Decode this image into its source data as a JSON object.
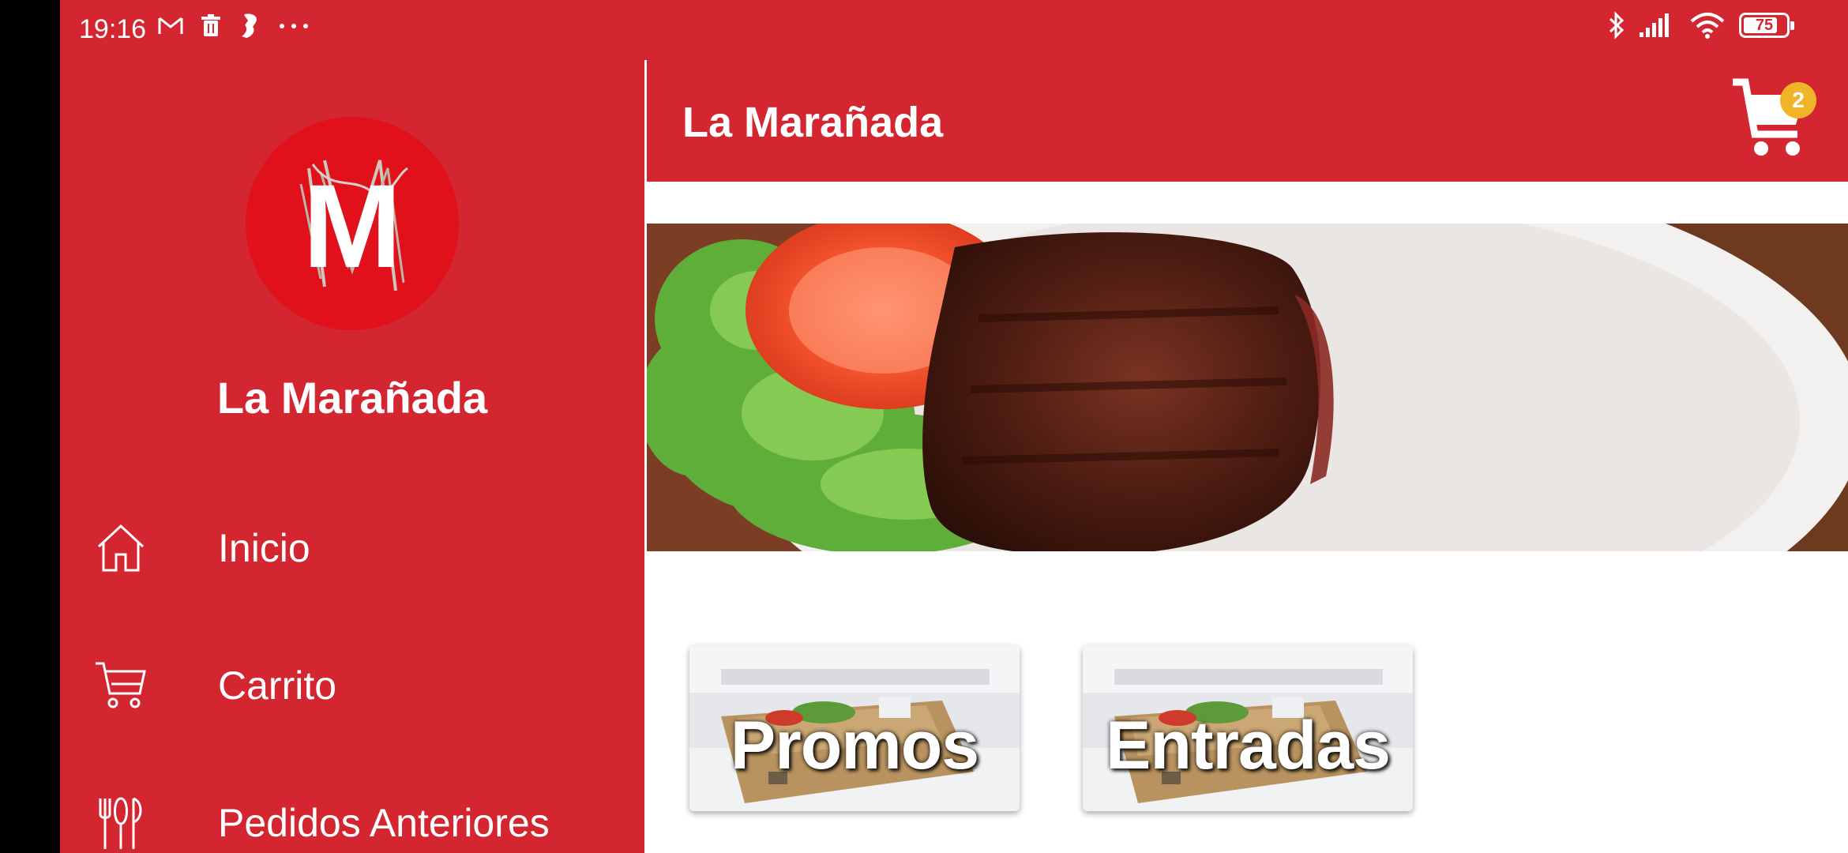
{
  "status_bar": {
    "time": "19:16",
    "left_icons": [
      "gmail-icon",
      "trash-icon",
      "app-notification-icon",
      "more-dots-icon"
    ],
    "right_icons": [
      "bluetooth-icon",
      "signal-icon",
      "wifi-icon"
    ],
    "battery": "75"
  },
  "drawer": {
    "logo_letter": "M",
    "title": "La Marañada",
    "items": [
      {
        "label": "Inicio",
        "icon": "home-icon"
      },
      {
        "label": "Carrito",
        "icon": "cart-icon"
      },
      {
        "label": "Pedidos Anteriores",
        "icon": "utensils-icon"
      }
    ]
  },
  "appbar": {
    "title": "La Marañada",
    "cart_count": "2"
  },
  "categories": [
    {
      "label": "Promos"
    },
    {
      "label": "Entradas"
    }
  ],
  "colors": {
    "primary": "#d32630",
    "badge": "#f0b429",
    "logo_bg": "#e0111a"
  }
}
